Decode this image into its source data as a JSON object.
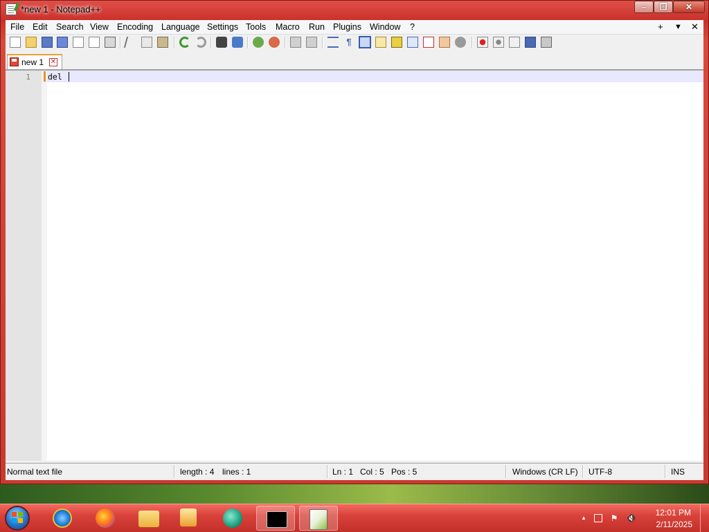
{
  "window": {
    "title": "*new 1 - Notepad++",
    "controls": {
      "minimize": "‒",
      "maximize": "❐",
      "close": "✕"
    }
  },
  "menu": {
    "items": [
      "File",
      "Edit",
      "Search",
      "View",
      "Encoding",
      "Language",
      "Settings",
      "Tools",
      "Macro",
      "Run",
      "Plugins",
      "Window",
      "?"
    ],
    "right": {
      "plus": "+",
      "dropdown": "▼",
      "close": "✕"
    }
  },
  "toolbar": {
    "icons": [
      "new-file-icon",
      "open-file-icon",
      "save-icon",
      "save-all-icon",
      "close-icon",
      "close-all-icon",
      "print-icon",
      "cut-icon",
      "copy-icon",
      "paste-icon",
      "undo-icon",
      "redo-icon",
      "find-icon",
      "replace-icon",
      "zoom-in-icon",
      "zoom-out-icon",
      "sync-vertical-icon",
      "sync-horizontal-icon",
      "word-wrap-icon",
      "show-all-chars-icon",
      "indent-guide-icon",
      "user-language-icon",
      "doc-map-icon",
      "doc-list-icon",
      "function-list-icon",
      "folder-workspace-icon",
      "monitoring-icon",
      "record-macro-icon",
      "stop-record-icon",
      "play-macro-icon",
      "run-macro-multiple-icon",
      "save-macro-icon"
    ]
  },
  "tabs": [
    {
      "label": "new 1",
      "close": "✕"
    }
  ],
  "editor": {
    "lines": [
      {
        "number": "1",
        "text": "del "
      }
    ]
  },
  "statusbar": {
    "file_type": "Normal text file",
    "length": "length : 4",
    "lines": "lines : 1",
    "ln": "Ln : 1",
    "col": "Col : 5",
    "pos": "Pos : 5",
    "eol": "Windows (CR LF)",
    "encoding": "UTF-8",
    "mode": "INS"
  },
  "taskbar": {
    "apps": [
      "internet-explorer-icon",
      "firefox-icon",
      "file-explorer-icon",
      "media-player-icon",
      "chat-app-icon",
      "command-prompt-icon",
      "notepad-plus-plus-icon"
    ],
    "active_app": "notepad-plus-plus-icon",
    "tray": {
      "show_hidden": "▲",
      "time": "12:01 PM",
      "date": "2/11/2025"
    }
  }
}
